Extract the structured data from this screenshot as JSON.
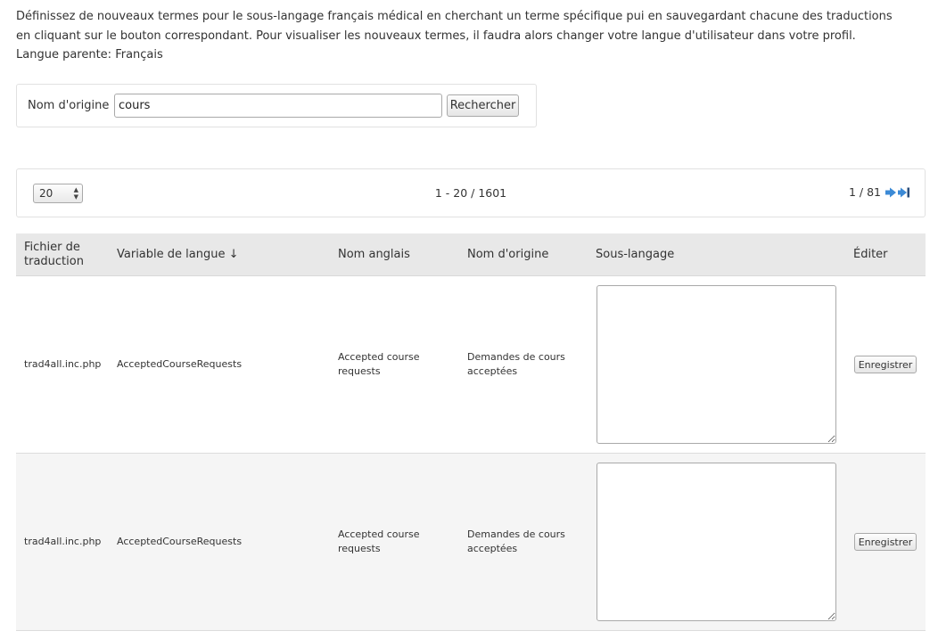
{
  "intro": {
    "description": "Définissez de nouveaux termes pour le sous-langage français médical en cherchant un terme spécifique pui en sauvegardant chacune des traductions en cliquant sur le bouton correspondant. Pour visualiser les nouveaux termes, il faudra alors changer votre langue d'utilisateur dans votre profil.",
    "parent_language": "Langue parente: Français"
  },
  "search": {
    "label": "Nom d'origine  :",
    "value": "cours",
    "button_label": "Rechercher"
  },
  "pager": {
    "per_page": "20",
    "range": "1 - 20 / 1601",
    "page_info": "1 / 81",
    "next_icon": "next-arrow-icon",
    "last_icon": "last-page-icon"
  },
  "table": {
    "headers": {
      "file": "Fichier de traduction",
      "variable": "Variable de langue ↓",
      "english": "Nom anglais",
      "origin": "Nom d'origine",
      "sublanguage": "Sous-langage",
      "edit": "Éditer"
    },
    "rows": [
      {
        "file": "trad4all.inc.php",
        "variable": "AcceptedCourseRequests",
        "english": "Accepted course requests",
        "origin": "Demandes de cours acceptées",
        "sublanguage": "",
        "save_label": "Enregistrer"
      },
      {
        "file": "trad4all.inc.php",
        "variable": "AcceptedCourseRequests",
        "english": "Accepted course requests",
        "origin": "Demandes de cours acceptées",
        "sublanguage": "",
        "save_label": "Enregistrer"
      }
    ]
  },
  "colors": {
    "nav_icon": "#3c8ad6",
    "header_bg": "#e8e8e8",
    "stripe_bg": "#f5f5f5"
  }
}
